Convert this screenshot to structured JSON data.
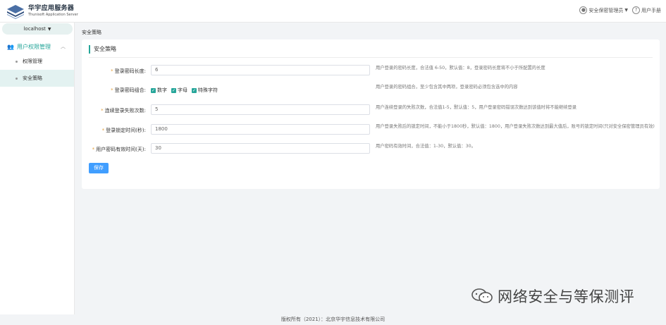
{
  "app": {
    "title": "华宇应用服务器",
    "subtitle": "Thunisoft Application Server"
  },
  "header": {
    "user_label": "安全保密管理员",
    "manual_label": "用户手册"
  },
  "sidebar": {
    "host": "localhost",
    "group": "用户权限管理",
    "items": [
      {
        "label": "权限管理",
        "active": false
      },
      {
        "label": "安全策略",
        "active": true
      }
    ]
  },
  "breadcrumb": "安全策略",
  "card": {
    "title": "安全策略",
    "fields": [
      {
        "label": "登录密码长度:",
        "value": "6",
        "hint": "用户登录的密码长度，合法值 6-50，默认值：8，登录密码长度将不小于所配置的长度"
      },
      {
        "label": "登录密码组合:",
        "hint": "用户登录的密码组合，至少包含其中两项，登录密码必须包含选中的内容"
      },
      {
        "label": "连续登录失败次数:",
        "value": "5",
        "hint": "用户连续登录的失败次数，合法值1-5，默认值：5，用户登录密码错误次数达到该值时将不能继续登录"
      },
      {
        "label": "登录锁定时间(秒):",
        "value": "1800",
        "hint": "用户登录失败后的锁定时间，不能小于1800秒，默认值：1800，用户登录失败次数达到最大值后，账号的锁定时间(只对安全保密管理员有效)"
      },
      {
        "label": "用户密码有效时间(天):",
        "value": "30",
        "hint": "用户密码有效时间，合法值：1-30，默认值：30。"
      }
    ],
    "checks": [
      {
        "label": "数字",
        "checked": true
      },
      {
        "label": "字母",
        "checked": true
      },
      {
        "label": "特殊字符",
        "checked": true
      }
    ],
    "save_label": "保存"
  },
  "footer": "版权所有（2021）：北京华宇信息技术有限公司",
  "watermark": "网络安全与等保测评",
  "colors": {
    "accent": "#26a69a",
    "button": "#409eff",
    "required": "#e6a23c"
  }
}
